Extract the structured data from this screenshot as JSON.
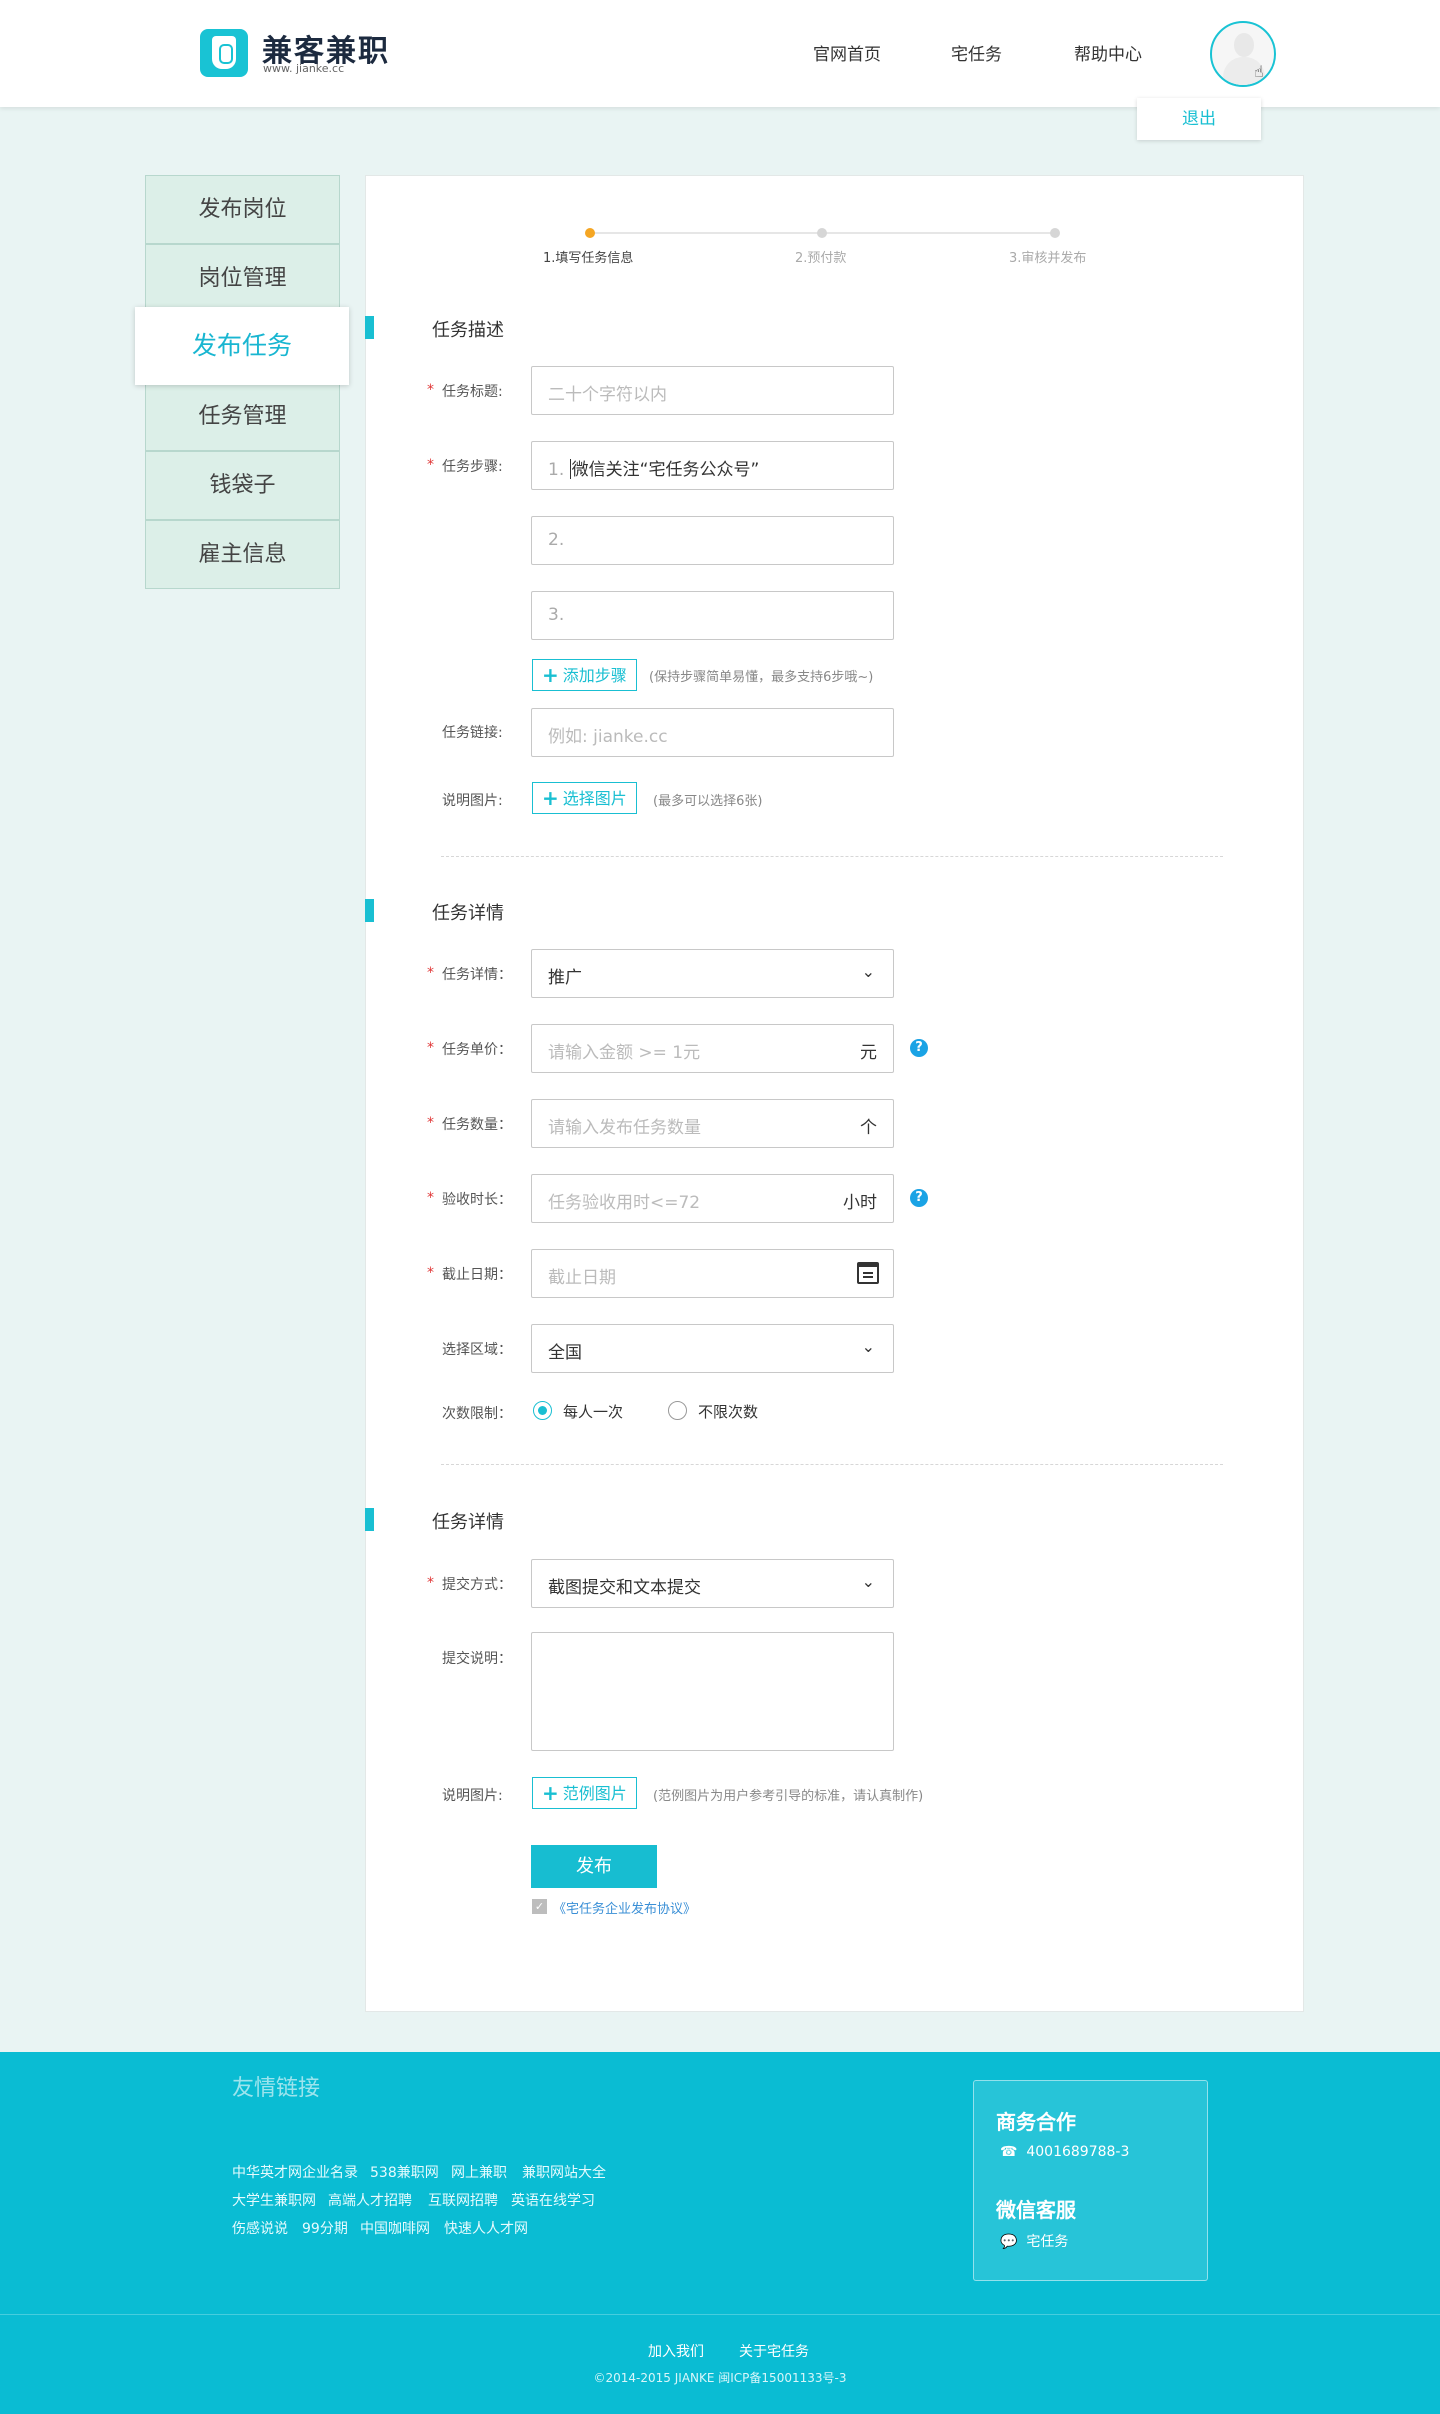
{
  "header": {
    "logo_title": "兼客兼职",
    "logo_sub": "www. jianke.cc",
    "nav": [
      "官网首页",
      "宅任务",
      "帮助中心"
    ],
    "logout": "退出"
  },
  "sidebar": {
    "items": [
      "发布岗位",
      "岗位管理",
      "发布任务",
      "任务管理",
      "钱袋子",
      "雇主信息"
    ],
    "active_index": 2
  },
  "steps": [
    "1.填写任务信息",
    "2.预付款",
    "3.审核并发布"
  ],
  "section1": {
    "title": "任务描述",
    "title_label": "任务标题:",
    "title_placeholder": "二十个字符以内",
    "steps_label": "任务步骤:",
    "step_rows": [
      {
        "num": "1.",
        "value": "微信关注“宅任务公众号”"
      },
      {
        "num": "2.",
        "value": ""
      },
      {
        "num": "3.",
        "value": ""
      }
    ],
    "add_step_btn": "添加步骤",
    "add_step_hint": "(保持步骤简单易懂，最多支持6步哦~)",
    "link_label": "任务链接:",
    "link_placeholder": "例如: jianke.cc",
    "image_label": "说明图片:",
    "image_btn": "选择图片",
    "image_hint": "(最多可以选择6张)"
  },
  "section2": {
    "title": "任务详情",
    "type_label": "任务详情：",
    "type_value": "推广",
    "price_label": "任务单价：",
    "price_placeholder": "请输入金额 >= 1元",
    "price_unit": "元",
    "count_label": "任务数量：",
    "count_placeholder": "请输入发布任务数量",
    "count_unit": "个",
    "review_label": "验收时长：",
    "review_placeholder": "任务验收用时<=72",
    "review_unit": "小时",
    "deadline_label": "截止日期：",
    "deadline_placeholder": "截止日期",
    "region_label": "选择区域：",
    "region_value": "全国",
    "limit_label": "次数限制：",
    "limit_options": [
      "每人一次",
      "不限次数"
    ],
    "limit_selected": 0
  },
  "section3": {
    "title": "任务详情",
    "submit_label": "提交方式：",
    "submit_value": "截图提交和文本提交",
    "desc_label": "提交说明：",
    "image_label": "说明图片:",
    "image_btn": "范例图片",
    "image_hint": "(范例图片为用户参考引导的标准，请认真制作)"
  },
  "publish_btn": "发布",
  "agreement": "《宅任务企业发布协议》",
  "footer": {
    "links_title": "友情链接",
    "links_rows": [
      [
        "中华英才网企业名录",
        "538兼职网",
        "网上兼职",
        "兼职网站大全"
      ],
      [
        "大学生兼职网",
        "高端人才招聘",
        "互联网招聘",
        "英语在线学习"
      ],
      [
        "伤感说说",
        "99分期",
        "中国咖啡网",
        "快速人人才网"
      ]
    ],
    "biz_title": "商务合作",
    "phone": "4001689788-3",
    "wechat_title": "微信客服",
    "wechat": "宅任务",
    "bottom_links": [
      "加入我们",
      "关于宅任务"
    ],
    "copyright": "©2014-2015 JIANKE 闽ICP备15001133号-3"
  },
  "colors": {
    "accent": "#19bfd2",
    "required": "#e03636",
    "step_active": "#f5a623"
  }
}
